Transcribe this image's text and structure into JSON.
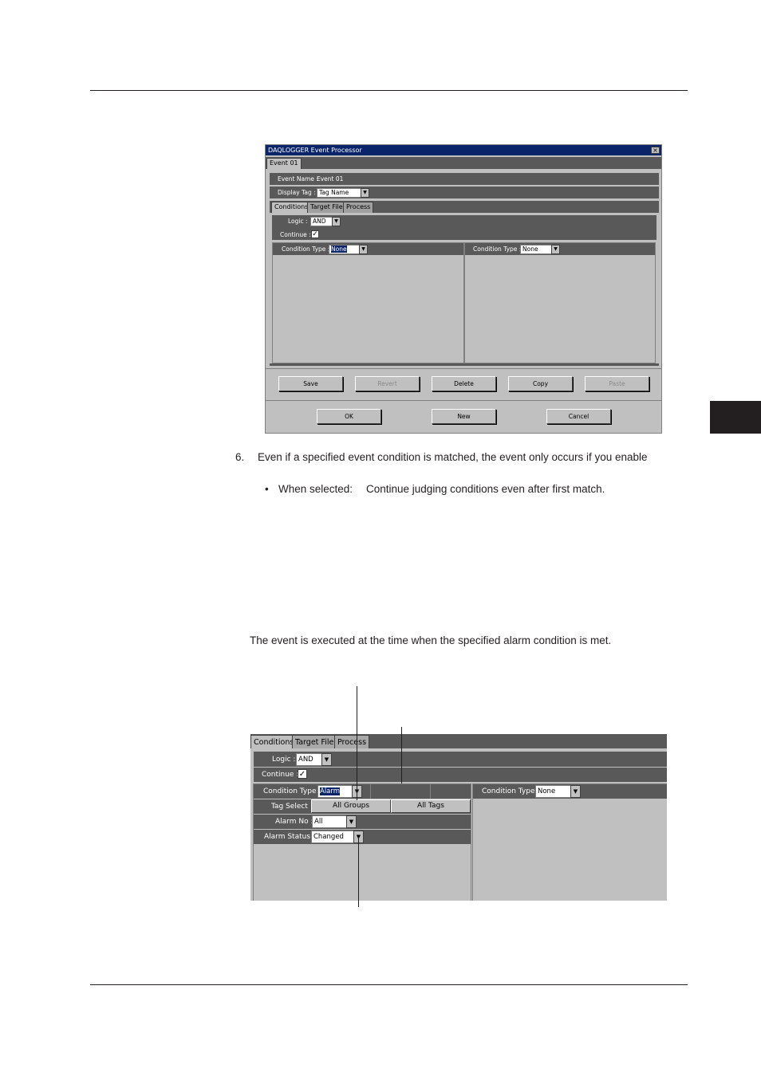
{
  "dialog": {
    "title": "DAQLOGGER Event Processor",
    "close_glyph": "×",
    "event_tab": "Event 01",
    "event_name_label": "Event Name :",
    "event_name_value": "Event 01",
    "display_tag_label": "Display Tag :",
    "display_tag_value": "Tag Name",
    "tabs": [
      "Conditions",
      "Target File",
      "Process"
    ],
    "logic_label": "Logic :",
    "logic_value": "AND",
    "continue_label": "Continue :",
    "continue_checked": true,
    "left_condition_label": "Condition Type :",
    "left_condition_value": "None",
    "right_condition_label": "Condition Type :",
    "right_condition_value": "None",
    "buttons": {
      "save": "Save",
      "revert": "Revert",
      "delete": "Delete",
      "copy": "Copy",
      "paste": "Paste",
      "ok": "OK",
      "new": "New",
      "cancel": "Cancel"
    }
  },
  "step6": {
    "number": "6.",
    "text": "Even if a specified event condition is matched, the event only occurs if you enable",
    "bullet": "•",
    "bullet_label": "When selected:",
    "bullet_text": "Continue judging conditions even after first match."
  },
  "alarm_description": "The event is executed at the time when the specified alarm condition is met.",
  "alarm_screenshot": {
    "tabs": [
      "Conditions",
      "Target File",
      "Process"
    ],
    "logic_label": "Logic :",
    "logic_value": "AND",
    "continue_label": "Continue :",
    "continue_checked": true,
    "left_condition_label": "Condition Type :",
    "left_condition_value": "Alarm",
    "right_condition_label": "Condition Type :",
    "right_condition_value": "None",
    "tag_select_label": "Tag Select",
    "all_groups": "All Groups",
    "all_tags": "All Tags",
    "alarm_no_label": "Alarm No :",
    "alarm_no_value": "All",
    "alarm_status_label": "Alarm Status :",
    "alarm_status_value": "Changed"
  },
  "glyphs": {
    "check": "✓",
    "arrow": "▼"
  },
  "colors": {
    "title_bar": "#0a246a",
    "panel_dark": "#595959",
    "panel_light": "#c0c0c0"
  }
}
